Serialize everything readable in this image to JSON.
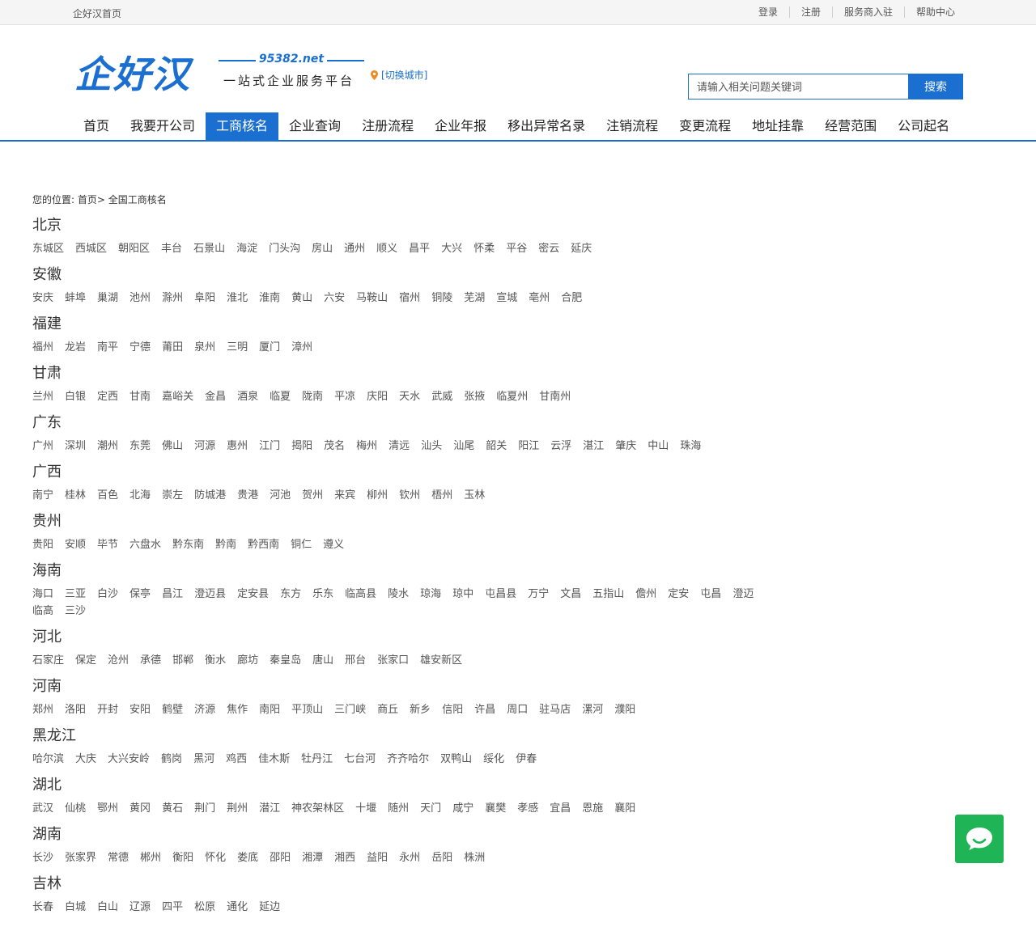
{
  "topbar": {
    "home": "企好汉首页",
    "links": [
      "登录",
      "注册",
      "服务商入驻",
      "帮助中心"
    ]
  },
  "logo": {
    "text": "企好汉",
    "url": "95382.net",
    "slogan": "一站式企业服务平台"
  },
  "city_switch": "[切换城市]",
  "search": {
    "placeholder": "请输入相关问题关键词",
    "button": "搜索"
  },
  "nav": {
    "items": [
      "首页",
      "我要开公司",
      "工商核名",
      "企业查询",
      "注册流程",
      "企业年报",
      "移出异常名录",
      "注销流程",
      "变更流程",
      "地址挂靠",
      "经营范围",
      "公司起名"
    ],
    "active": "工商核名"
  },
  "breadcrumb": {
    "label": "您的位置:",
    "home": "首页>",
    "current": "全国工商核名"
  },
  "regions": [
    {
      "name": "北京",
      "cities": [
        "东城区",
        "西城区",
        "朝阳区",
        "丰台",
        "石景山",
        "海淀",
        "门头沟",
        "房山",
        "通州",
        "顺义",
        "昌平",
        "大兴",
        "怀柔",
        "平谷",
        "密云",
        "延庆"
      ]
    },
    {
      "name": "安徽",
      "cities": [
        "安庆",
        "蚌埠",
        "巢湖",
        "池州",
        "滁州",
        "阜阳",
        "淮北",
        "淮南",
        "黄山",
        "六安",
        "马鞍山",
        "宿州",
        "铜陵",
        "芜湖",
        "宣城",
        "亳州",
        "合肥"
      ]
    },
    {
      "name": "福建",
      "cities": [
        "福州",
        "龙岩",
        "南平",
        "宁德",
        "莆田",
        "泉州",
        "三明",
        "厦门",
        "漳州"
      ]
    },
    {
      "name": "甘肃",
      "cities": [
        "兰州",
        "白银",
        "定西",
        "甘南",
        "嘉峪关",
        "金昌",
        "酒泉",
        "临夏",
        "陇南",
        "平凉",
        "庆阳",
        "天水",
        "武威",
        "张掖",
        "临夏州",
        "甘南州"
      ]
    },
    {
      "name": "广东",
      "cities": [
        "广州",
        "深圳",
        "潮州",
        "东莞",
        "佛山",
        "河源",
        "惠州",
        "江门",
        "揭阳",
        "茂名",
        "梅州",
        "清远",
        "汕头",
        "汕尾",
        "韶关",
        "阳江",
        "云浮",
        "湛江",
        "肇庆",
        "中山",
        "珠海"
      ]
    },
    {
      "name": "广西",
      "cities": [
        "南宁",
        "桂林",
        "百色",
        "北海",
        "崇左",
        "防城港",
        "贵港",
        "河池",
        "贺州",
        "来宾",
        "柳州",
        "钦州",
        "梧州",
        "玉林"
      ]
    },
    {
      "name": "贵州",
      "cities": [
        "贵阳",
        "安顺",
        "毕节",
        "六盘水",
        "黔东南",
        "黔南",
        "黔西南",
        "铜仁",
        "遵义"
      ]
    },
    {
      "name": "海南",
      "cities": [
        "海口",
        "三亚",
        "白沙",
        "保亭",
        "昌江",
        "澄迈县",
        "定安县",
        "东方",
        "乐东",
        "临高县",
        "陵水",
        "琼海",
        "琼中",
        "屯昌县",
        "万宁",
        "文昌",
        "五指山",
        "儋州",
        "定安",
        "屯昌",
        "澄迈",
        "临高",
        "三沙"
      ]
    },
    {
      "name": "河北",
      "cities": [
        "石家庄",
        "保定",
        "沧州",
        "承德",
        "邯郸",
        "衡水",
        "廊坊",
        "秦皇岛",
        "唐山",
        "邢台",
        "张家口",
        "雄安新区"
      ]
    },
    {
      "name": "河南",
      "cities": [
        "郑州",
        "洛阳",
        "开封",
        "安阳",
        "鹤壁",
        "济源",
        "焦作",
        "南阳",
        "平顶山",
        "三门峡",
        "商丘",
        "新乡",
        "信阳",
        "许昌",
        "周口",
        "驻马店",
        "漯河",
        "濮阳"
      ]
    },
    {
      "name": "黑龙江",
      "cities": [
        "哈尔滨",
        "大庆",
        "大兴安岭",
        "鹤岗",
        "黑河",
        "鸡西",
        "佳木斯",
        "牡丹江",
        "七台河",
        "齐齐哈尔",
        "双鸭山",
        "绥化",
        "伊春"
      ]
    },
    {
      "name": "湖北",
      "cities": [
        "武汉",
        "仙桃",
        "鄂州",
        "黄冈",
        "黄石",
        "荆门",
        "荆州",
        "潜江",
        "神农架林区",
        "十堰",
        "随州",
        "天门",
        "咸宁",
        "襄樊",
        "孝感",
        "宜昌",
        "恩施",
        "襄阳"
      ]
    },
    {
      "name": "湖南",
      "cities": [
        "长沙",
        "张家界",
        "常德",
        "郴州",
        "衡阳",
        "怀化",
        "娄底",
        "邵阳",
        "湘潭",
        "湘西",
        "益阳",
        "永州",
        "岳阳",
        "株洲"
      ]
    },
    {
      "name": "吉林",
      "cities": [
        "长春",
        "白城",
        "白山",
        "辽源",
        "四平",
        "松原",
        "通化",
        "延边"
      ]
    }
  ],
  "icons": {
    "location": "location-pin-icon",
    "chat": "chat-bubble-icon"
  },
  "colors": {
    "brand": "#1a6fd1",
    "chat": "#1fb556"
  }
}
